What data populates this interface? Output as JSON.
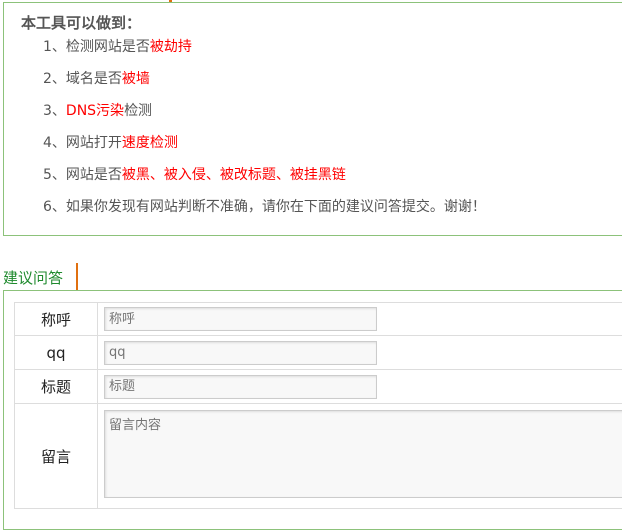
{
  "intro": {
    "title": "本工具可以做到：",
    "items": [
      {
        "num": "1、",
        "a": "检测网站是否",
        "r": "被劫持",
        "b": ""
      },
      {
        "num": "2、",
        "a": "域名是否",
        "r": "被墙",
        "b": ""
      },
      {
        "num": "3、",
        "a": "",
        "r": "DNS污染",
        "b": "检测"
      },
      {
        "num": "4、",
        "a": "网站打开",
        "r": "速度检测",
        "b": ""
      },
      {
        "num": "5、",
        "a": "网站是否",
        "r": "被黑、被入侵、被改标题、被挂黑链",
        "b": ""
      },
      {
        "num": "6、",
        "a": "如果你发现有网站判断不准确，请你在下面的建议问答提交。谢谢！",
        "r": "",
        "b": ""
      }
    ]
  },
  "form": {
    "section_title": "建议问答",
    "fields": [
      {
        "label": "称呼",
        "placeholder": "称呼"
      },
      {
        "label": "qq",
        "placeholder": "qq"
      },
      {
        "label": "标题",
        "placeholder": "标题"
      },
      {
        "label": "留言",
        "placeholder": "留言内容"
      }
    ]
  }
}
